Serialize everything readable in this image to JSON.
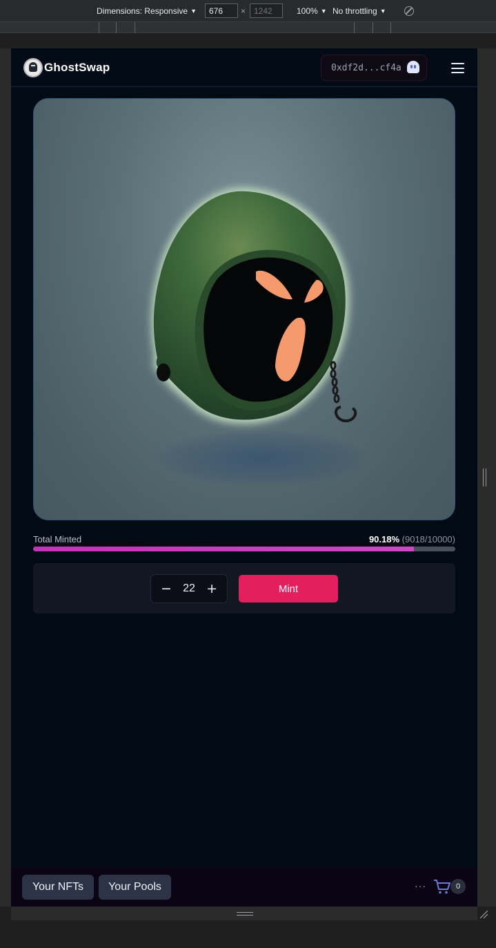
{
  "devtools": {
    "dimensions_label": "Dimensions: Responsive",
    "width_value": "676",
    "height_placeholder": "1242",
    "times": "×",
    "zoom": "100%",
    "throttling": "No throttling"
  },
  "app": {
    "brand": "GhostSwap",
    "wallet_address": "0xdf2d...cf4a"
  },
  "minting": {
    "label": "Total Minted",
    "percent_text": "90.18%",
    "count_text": "(9018/10000)",
    "minted": 9018,
    "total": 10000,
    "quantity": "22",
    "minus": "−",
    "plus": "+",
    "mint_label": "Mint"
  },
  "bottom_nav": {
    "your_nfts": "Your NFTs",
    "your_pools": "Your Pools",
    "more": "···",
    "cart_count": "0"
  },
  "colors": {
    "accent": "#e41f5f",
    "progress": "#c234b8",
    "background": "#020a14"
  },
  "icons": [
    "logo-icon",
    "ghost-icon",
    "menu-icon",
    "cart-icon",
    "more-icon",
    "rotate-icon"
  ]
}
